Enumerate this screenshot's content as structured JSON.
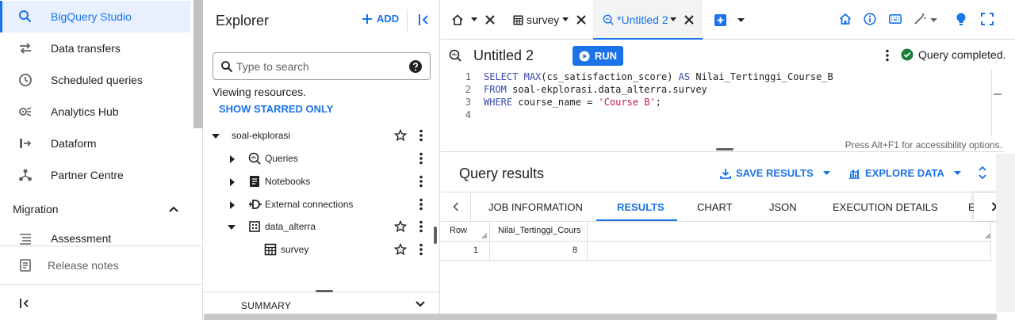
{
  "nav": {
    "items": [
      {
        "label": "BigQuery Studio",
        "icon": "search-icon",
        "active": true
      },
      {
        "label": "Data transfers",
        "icon": "transfer-icon"
      },
      {
        "label": "Scheduled queries",
        "icon": "clock-icon"
      },
      {
        "label": "Analytics Hub",
        "icon": "hub-icon"
      },
      {
        "label": "Dataform",
        "icon": "dataform-icon"
      },
      {
        "label": "Partner Centre",
        "icon": "partner-icon"
      }
    ],
    "section": "Migration",
    "section_items": [
      {
        "label": "Assessment",
        "icon": "list-icon"
      }
    ],
    "release_notes": "Release notes",
    "collapse_icon": "collapse-nav-icon"
  },
  "explorer": {
    "title": "Explorer",
    "add_label": "ADD",
    "search_placeholder": "Type to search",
    "viewing": "Viewing resources.",
    "starred_label": "SHOW STARRED ONLY",
    "tree": {
      "project": "soal-ekplorasi",
      "queries": "Queries",
      "notebooks": "Notebooks",
      "external": "External connections",
      "dataset": "data_alterra",
      "table": "survey"
    },
    "summary": "SUMMARY"
  },
  "tabs": {
    "survey": "survey",
    "untitled": "*Untitled 2"
  },
  "editor": {
    "title": "Untitled 2",
    "run_label": "RUN",
    "status": "Query completed.",
    "lines": [
      {
        "n": "1",
        "kw1": "SELECT",
        "t1": " ",
        "kw2": "MAX",
        "t2": "(cs_satisfaction_score) ",
        "kw3": "AS",
        "t3": " Nilai_Tertinggi_Course_B"
      },
      {
        "n": "2",
        "kw1": "FROM",
        "t1": " soal-ekplorasi.data_alterra.survey"
      },
      {
        "n": "3",
        "kw1": "WHERE",
        "t1": " course_name = ",
        "str": "'Course B'",
        "t2": ";"
      },
      {
        "n": "4"
      }
    ],
    "a11y": "Press Alt+F1 for accessibility options."
  },
  "results": {
    "title": "Query results",
    "save_label": "SAVE RESULTS",
    "explore_label": "EXPLORE DATA",
    "tabs": [
      "JOB INFORMATION",
      "RESULTS",
      "CHART",
      "JSON",
      "EXECUTION DETAILS",
      "E"
    ],
    "active_tab": "RESULTS",
    "columns": [
      "Row",
      "Nilai_Tertinggi_Cours"
    ],
    "rows": [
      [
        "1",
        "8"
      ]
    ]
  },
  "colors": {
    "accent": "#1a73e8",
    "success": "#188038"
  }
}
